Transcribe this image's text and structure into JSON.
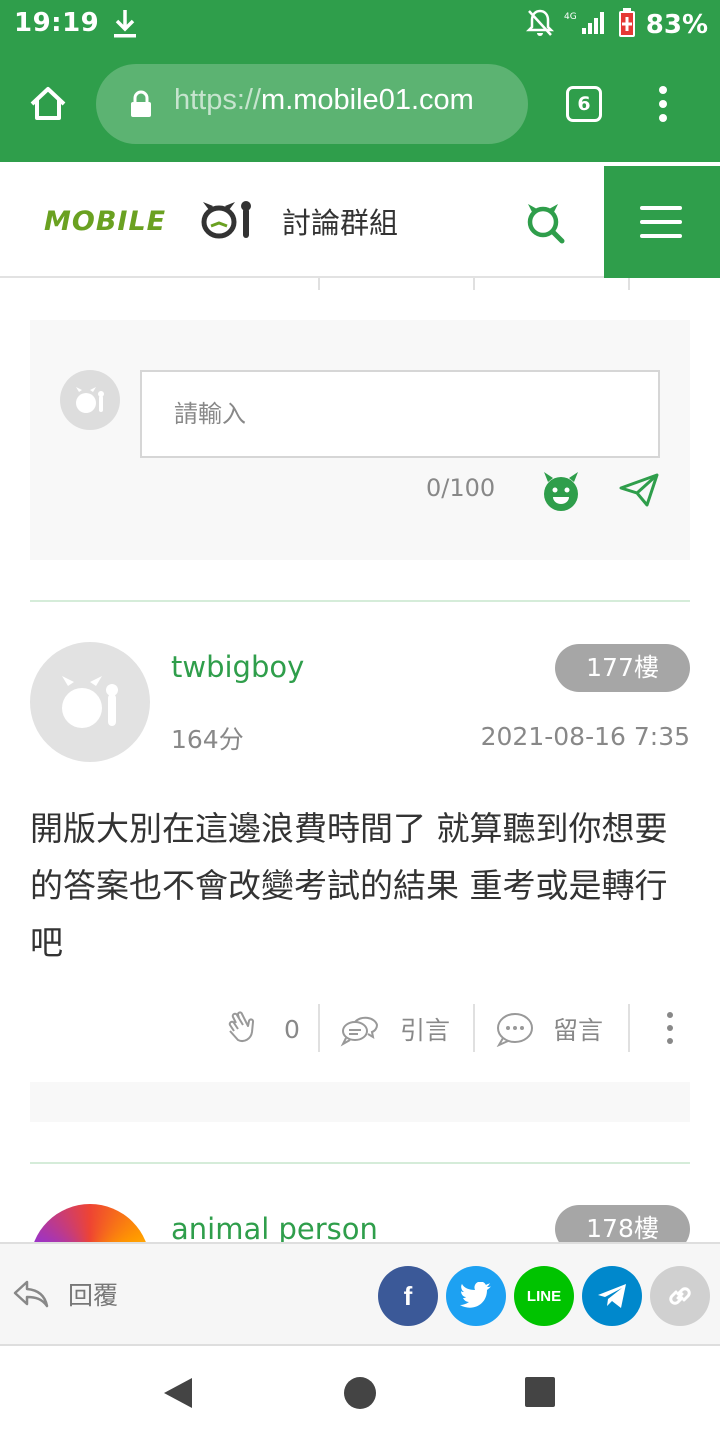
{
  "status_bar": {
    "time": "19:19",
    "network": "4G",
    "battery": "83%"
  },
  "browser": {
    "url_scheme": "https://",
    "url_host": "m.mobile01.com",
    "tab_count": "6"
  },
  "header": {
    "logo_text": "MOBILE01",
    "section_title": "討論群組"
  },
  "comment_box": {
    "placeholder": "請輸入",
    "counter": "0/100"
  },
  "post": {
    "username": "twbigboy",
    "score": "164分",
    "floor": "177樓",
    "date": "2021-08-16 7:35",
    "body": "開版大別在這邊浪費時間了 就算聽到你想要的答案也不會改變考試的結果 重考或是轉行吧",
    "actions": {
      "like_count": "0",
      "quote_label": "引言",
      "comment_label": "留言"
    }
  },
  "next_post": {
    "username": "animal person",
    "floor": "178樓"
  },
  "bottom_bar": {
    "reply_label": "回覆",
    "share": [
      {
        "name": "facebook",
        "label": "f",
        "color": "#3b5998"
      },
      {
        "name": "twitter",
        "label": "",
        "color": "#1da1f2"
      },
      {
        "name": "line",
        "label": "LINE",
        "color": "#00c300"
      },
      {
        "name": "telegram",
        "label": "",
        "color": "#0088cc"
      },
      {
        "name": "copy-link",
        "label": "",
        "color": "#d0d0d0"
      }
    ]
  },
  "colors": {
    "brand_green": "#2f9e4b",
    "badge_grey": "#a6a6a6"
  }
}
